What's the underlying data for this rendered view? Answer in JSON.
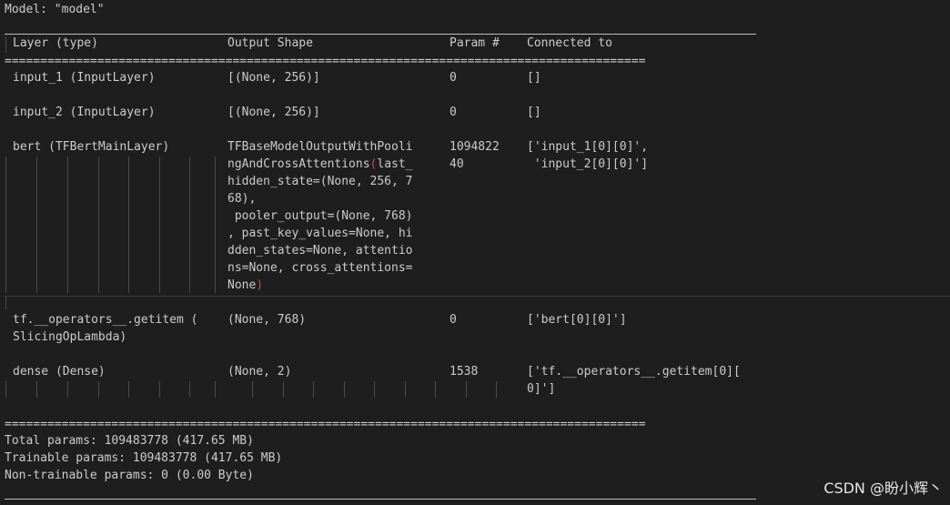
{
  "title": "Model: \"model\"",
  "headers": {
    "layer": "Layer (type)",
    "shape": "Output Shape",
    "param": "Param #",
    "conn": "Connected to"
  },
  "eq_line": "==========================================================================================",
  "rows": [
    {
      "layer": [
        "input_1 (InputLayer)"
      ],
      "shape": [
        "[(None, 256)]"
      ],
      "param": [
        "0"
      ],
      "conn": [
        "[]"
      ]
    },
    {
      "layer": [
        "input_2 (InputLayer)"
      ],
      "shape": [
        "[(None, 256)]"
      ],
      "param": [
        "0"
      ],
      "conn": [
        "[]"
      ]
    },
    {
      "layer": [
        "bert (TFBertMainLayer)"
      ],
      "shape": [
        "TFBaseModelOutputWithPooli",
        "ngAndCrossAttentions",
        "(",
        "last_",
        "hidden_state=(None, 256, 7",
        "68),",
        " pooler_output=(None, 768)",
        ", past_key_values=None, hi",
        "dden_states=None, attentio",
        "ns=None, cross_attentions=",
        "None",
        ")"
      ],
      "param": [
        "1094822",
        "40"
      ],
      "conn": [
        "['input_1[0][0]',",
        " 'input_2[0][0]']"
      ]
    },
    {
      "layer": [
        "tf.__operators__.getitem (",
        "SlicingOpLambda)"
      ],
      "shape": [
        "(None, 768)"
      ],
      "param": [
        "0"
      ],
      "conn": [
        "['bert[0][0]']"
      ]
    },
    {
      "layer": [
        "dense (Dense)"
      ],
      "shape": [
        "(None, 2)"
      ],
      "param": [
        "1538"
      ],
      "conn": [
        "['tf.__operators__.getitem[0][",
        "0]']"
      ]
    }
  ],
  "summary": {
    "total": "Total params: 109483778 (417.65 MB)",
    "trainable": "Trainable params: 109483778 (417.65 MB)",
    "non_trainable": "Non-trainable params: 0 (0.00 Byte)"
  },
  "watermark": "CSDN @盼小辉丶"
}
